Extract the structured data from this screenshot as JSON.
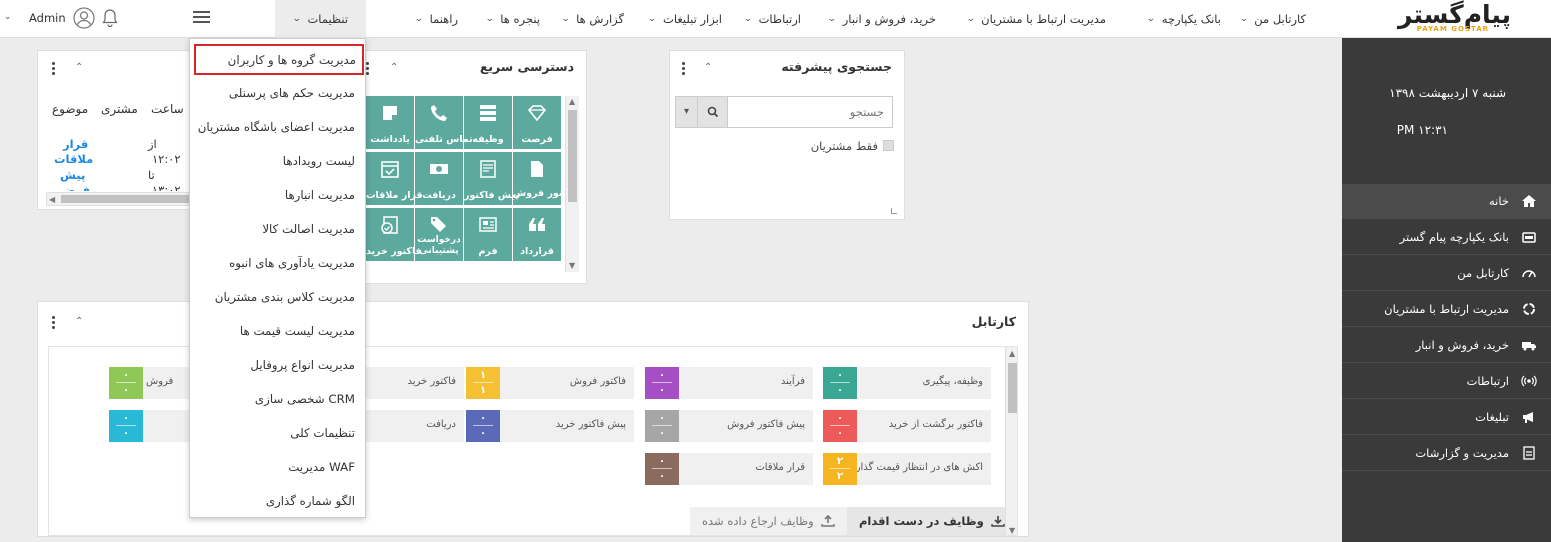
{
  "brand": {
    "logo_text": "پیام‌گستر",
    "logo_sub": "PAYAM GOSTAR",
    "colors": {
      "primary_teal": "#5ca99e",
      "highlight_red": "#d62828",
      "sidebar_bg": "#3a3a3a"
    }
  },
  "topnav": {
    "items": [
      "کارتابل من",
      "بانک یکپارچه",
      "مدیریت ارتباط با مشتریان",
      "خرید، فروش و انبار",
      "ارتباطات",
      "ابزار تبلیغات",
      "گزارش ها",
      "پنجره ها",
      "راهنما",
      "تنظیمات"
    ],
    "active": "تنظیمات",
    "user": "Admin",
    "icons": [
      "menu-icon",
      "bell-icon",
      "user-avatar-icon",
      "chevron-down-icon"
    ]
  },
  "dropdown": {
    "items": [
      "مدیریت گروه ها و کاربران",
      "مدیریت حکم های پرسنلی",
      "مدیریت اعضای باشگاه مشتریان",
      "لیست رویدادها",
      "مدیریت انبارها",
      "مدیریت اصالت کالا",
      "مدیریت یادآوری های انبوه",
      "مدیریت کلاس بندی مشتریان",
      "مدیریت لیست قیمت ها",
      "مدیریت انواع پروفایل",
      "شخصی سازی CRM",
      "تنظیمات کلی",
      "مدیریت WAF",
      "الگو شماره گذاری"
    ],
    "highlighted": "مدیریت گروه ها و کاربران"
  },
  "sidebar": {
    "date": "شنبه ۷ اردیبهشت ۱۳۹۸",
    "time": "PM ۱۲:۳۱",
    "items": [
      {
        "label": "خانه",
        "icon": "home-icon"
      },
      {
        "label": "بانک یکپارچه پیام گستر",
        "icon": "database-icon"
      },
      {
        "label": "کارتابل من",
        "icon": "dashboard-icon"
      },
      {
        "label": "مدیریت ارتباط با مشتریان",
        "icon": "crm-icon"
      },
      {
        "label": "خرید، فروش و انبار",
        "icon": "truck-icon"
      },
      {
        "label": "ارتباطات",
        "icon": "broadcast-icon"
      },
      {
        "label": "تبلیغات",
        "icon": "megaphone-icon"
      },
      {
        "label": "مدیریت و گزارشات",
        "icon": "report-icon"
      }
    ]
  },
  "advanced_search": {
    "title": "جستجوی پیشرفته",
    "placeholder": "جستجو",
    "only_customers": "فقط مشتریان"
  },
  "quick_access": {
    "title": "دسترسی سریع",
    "tiles": [
      {
        "label": "فرصت",
        "icon": "diamond-icon"
      },
      {
        "label": "وظیفه",
        "icon": "task-icon"
      },
      {
        "label": "تماس تلفنی",
        "icon": "phone-icon"
      },
      {
        "label": "یادداشت",
        "icon": "note-icon"
      },
      {
        "label": "فاکتور فروش",
        "icon": "invoice-icon"
      },
      {
        "label": "پیش فاکتور",
        "icon": "proforma-icon"
      },
      {
        "label": "دریافت",
        "icon": "money-icon"
      },
      {
        "label": "قرار ملاقات",
        "icon": "calendar-icon"
      },
      {
        "label": "قرارداد",
        "icon": "quote-icon"
      },
      {
        "label": "فرم",
        "icon": "form-icon"
      },
      {
        "label": "درخواست پشتیبانی",
        "icon": "tag-icon"
      },
      {
        "label": "فاکتور خرید",
        "icon": "purchase-invoice-icon"
      }
    ]
  },
  "small_widget": {
    "headers": [
      "موضوع",
      "مشتری",
      "ساعت"
    ],
    "subjects": [
      "قرار",
      "ملاقات",
      "پیش",
      "فرض"
    ],
    "times": [
      "از",
      "۱۲:۰۲",
      "تا",
      "۱۳:۰۲"
    ]
  },
  "kartabl": {
    "title": "کارتابل",
    "cards": [
      {
        "label": "وظیفه، پیگیری",
        "n1": "۰",
        "n2": "۰",
        "color": "#3aa694"
      },
      {
        "label": "فرآیند",
        "n1": "۰",
        "n2": "۰",
        "color": "#a64fc4"
      },
      {
        "label": "فاکتور فروش",
        "n1": "۱",
        "n2": "۱",
        "color": "#f5c033"
      },
      {
        "label": "فاکتور خرید",
        "n1": "",
        "n2": "",
        "color": ""
      },
      {
        "label": "فروش",
        "n1": "۰",
        "n2": "۰",
        "color": "#8fc857"
      },
      {
        "label": "فاکتور برگشت از خرید",
        "n1": "۰",
        "n2": "۰",
        "color": "#ed5a5a"
      },
      {
        "label": "پیش فاکتور فروش",
        "n1": "۰",
        "n2": "۰",
        "color": "#a6a6a6"
      },
      {
        "label": "پیش فاکتور خرید",
        "n1": "۰",
        "n2": "۰",
        "color": "#5a6ab8"
      },
      {
        "label": "دریافت",
        "n1": "",
        "n2": "",
        "color": ""
      },
      {
        "label": "",
        "n1": "۰",
        "n2": "۰",
        "color": "#29b8d6"
      },
      {
        "label": "اکش های در انتظار قیمت گذاری",
        "n1": "۲",
        "n2": "۲",
        "color": "#f5b521"
      },
      {
        "label": "قرار ملاقات",
        "n1": "۰",
        "n2": "۰",
        "color": "#8a6b5e"
      }
    ],
    "tabs": [
      "وظایف در دست اقدام",
      "وظایف ارجاع داده شده"
    ]
  }
}
